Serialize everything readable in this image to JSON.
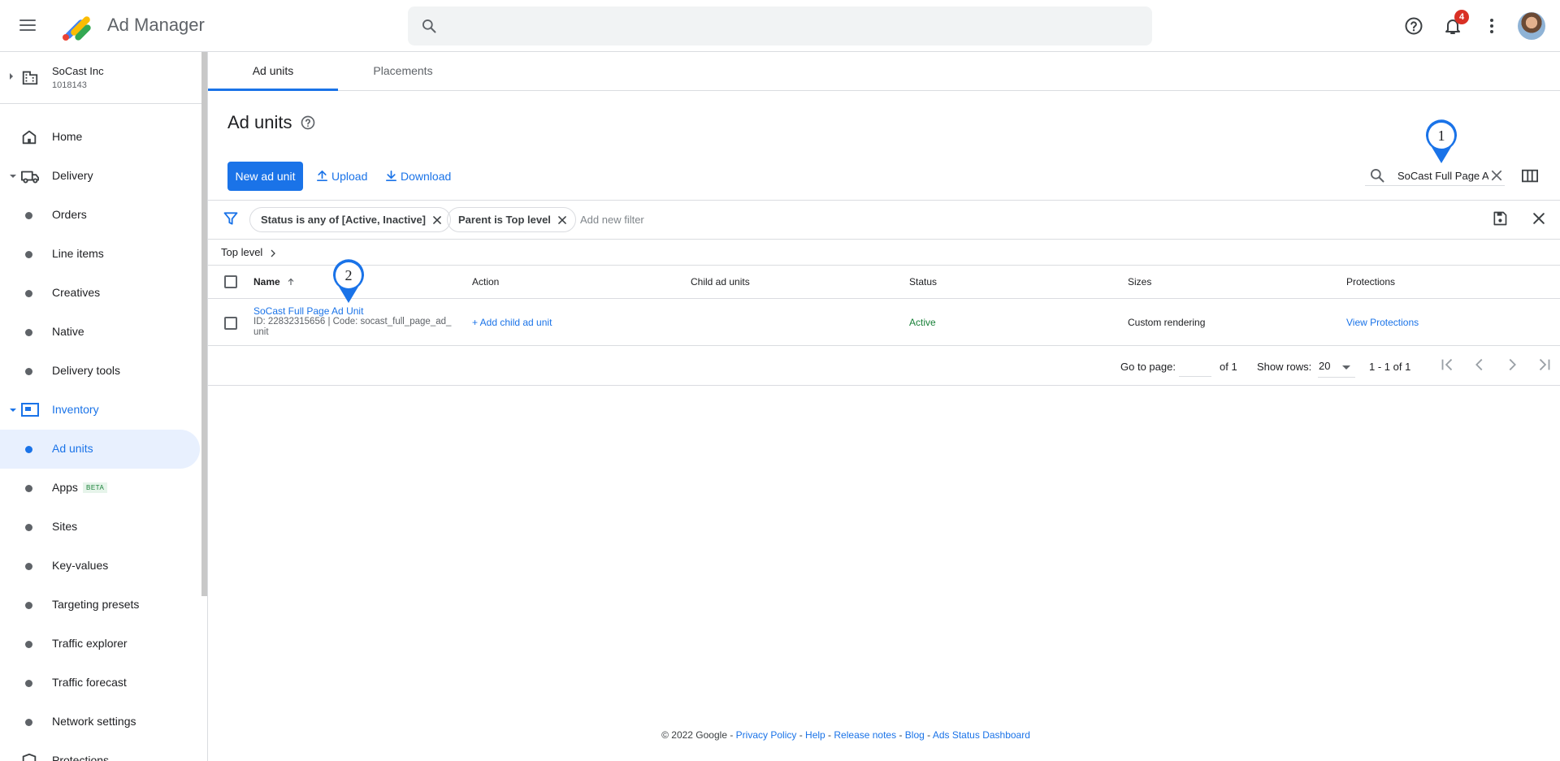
{
  "header": {
    "app_title": "Ad Manager",
    "search_placeholder": "",
    "notification_count": "4",
    "icons": [
      "menu-icon",
      "search-icon",
      "help-icon",
      "notifications-icon",
      "more-vert-icon"
    ]
  },
  "account": {
    "name": "SoCast Inc",
    "id": "1018143"
  },
  "sidebar": {
    "items": [
      {
        "label": "Home",
        "icon": "home-icon"
      },
      {
        "label": "Delivery",
        "icon": "truck-icon"
      },
      {
        "label": "Orders"
      },
      {
        "label": "Line items"
      },
      {
        "label": "Creatives"
      },
      {
        "label": "Native"
      },
      {
        "label": "Delivery tools"
      },
      {
        "label": "Inventory",
        "icon": "inventory-icon"
      },
      {
        "label": "Ad units",
        "selected": true
      },
      {
        "label": "Apps",
        "badge": "BETA"
      },
      {
        "label": "Sites"
      },
      {
        "label": "Key-values"
      },
      {
        "label": "Targeting presets"
      },
      {
        "label": "Traffic explorer"
      },
      {
        "label": "Traffic forecast"
      },
      {
        "label": "Network settings"
      },
      {
        "label": "Protections",
        "icon": "shield-icon"
      }
    ]
  },
  "tabs": [
    {
      "label": "Ad units",
      "active": true
    },
    {
      "label": "Placements",
      "active": false
    }
  ],
  "page": {
    "title": "Ad units",
    "new_button": "New ad unit",
    "upload": "Upload",
    "download": "Download",
    "table_search_value": "SoCast Full Page Ad Unit"
  },
  "filters": {
    "chips": [
      "Status is any of [Active, Inactive]",
      "Parent is Top level"
    ],
    "add_placeholder": "Add new filter"
  },
  "breadcrumb": "Top level",
  "table": {
    "columns": [
      "Name",
      "Action",
      "Child ad units",
      "Status",
      "Sizes",
      "Protections"
    ],
    "rows": [
      {
        "name": "SoCast Full Page Ad Unit",
        "meta_line1": "ID: 22832315656 | Code: socast_full_page_ad_",
        "meta_line2": "unit",
        "action": "+ Add child ad unit",
        "child_ad_units": "",
        "status": "Active",
        "sizes": "Custom rendering",
        "protections": "View Protections"
      }
    ]
  },
  "pagination": {
    "goto_label": "Go to page:",
    "page_value": "",
    "of_label": "of 1",
    "show_rows_label": "Show rows:",
    "rows_value": "20",
    "range": "1 - 1 of 1"
  },
  "footer": {
    "copyright": "© 2022 Google - ",
    "links": [
      "Privacy Policy",
      "Help",
      "Release notes",
      "Blog",
      "Ads Status Dashboard"
    ],
    "separator": " - "
  },
  "annotations": [
    "1",
    "2"
  ],
  "colors": {
    "primary": "#1a73e8",
    "active_green": "#188038",
    "badge_red": "#d93025",
    "pin": "#1a73e8"
  }
}
